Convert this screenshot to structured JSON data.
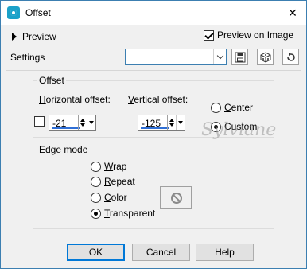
{
  "window": {
    "title": "Offset",
    "close_glyph": "✕"
  },
  "header": {
    "preview_label": "Preview",
    "preview_on_image_label": "Preview on Image",
    "preview_on_image_checked": true,
    "settings_label": "Settings",
    "settings_value": ""
  },
  "toolbar": {
    "save_icon": "floppy-disk-icon",
    "random_icon": "dice-icon",
    "reset_icon": "reset-arrow-icon"
  },
  "offset": {
    "group_title": "Offset",
    "horizontal_label_accel": "H",
    "horizontal_label_rest": "orizontal offset:",
    "vertical_label_accel": "V",
    "vertical_label_rest": "ertical offset:",
    "horizontal_value": "-21",
    "vertical_value": "-125",
    "center_label_accel": "C",
    "center_label_rest": "enter",
    "custom_label_accel": "C",
    "custom_label_rest": "ustom",
    "selected": "custom"
  },
  "edge_mode": {
    "group_title": "Edge mode",
    "options": [
      {
        "accel": "W",
        "rest": "rap"
      },
      {
        "accel": "R",
        "rest": "epeat"
      },
      {
        "accel": "C",
        "rest": "olor"
      },
      {
        "accel": "T",
        "rest": "ransparent"
      }
    ],
    "selected": "transparent"
  },
  "watermark_text": "Sylviane",
  "buttons": {
    "ok": "OK",
    "cancel": "Cancel",
    "help": "Help"
  },
  "colors": {
    "accent": "#0078d7",
    "spin_underline": "#2f6fd6",
    "app_icon": "#1ba1c9"
  }
}
